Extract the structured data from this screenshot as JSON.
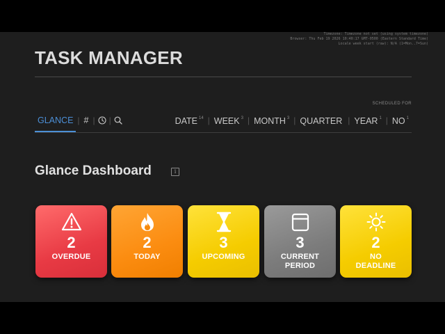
{
  "debug": {
    "lines": [
      "Timezone: Timezone not set (using system timezone)",
      "Browser: Thu Feb 19 2026 10:40:17 GMT-0500 (Eastern Standard Time)",
      "Locale week start (raw): N/A (1=Mon..7=Sun)"
    ]
  },
  "app": {
    "title": "TASK MANAGER"
  },
  "nav": {
    "tabs": [
      {
        "label": "GLANCE",
        "active": true
      },
      {
        "label": "#",
        "active": false
      }
    ],
    "icons": [
      "clock-icon",
      "search-icon"
    ],
    "scheduled_for_label": "SCHEDULED FOR",
    "periods": [
      {
        "label": "DATE",
        "count": "14"
      },
      {
        "label": "WEEK",
        "count": "3"
      },
      {
        "label": "MONTH",
        "count": "3"
      },
      {
        "label": "QUARTER",
        "count": ""
      },
      {
        "label": "YEAR",
        "count": "1"
      },
      {
        "label": "NO",
        "count": "1"
      }
    ]
  },
  "dashboard": {
    "title": "Glance Dashboard",
    "info_icon_glyph": "i",
    "cards": [
      {
        "label": "OVERDUE",
        "count": "2",
        "icon": "warning-icon",
        "color": "#e83a44"
      },
      {
        "label": "TODAY",
        "count": "2",
        "icon": "flame-icon",
        "color": "#fb8c10"
      },
      {
        "label": "UPCOMING",
        "count": "3",
        "icon": "hourglass-icon",
        "color": "#f5cc00"
      },
      {
        "label": "CURRENT PERIOD",
        "label_line1": "CURRENT",
        "label_line2": "PERIOD",
        "count": "3",
        "icon": "calendar-icon",
        "color": "#7c7c7c"
      },
      {
        "label": "NO DEADLINE",
        "label_line1": "NO",
        "label_line2": "DEADLINE",
        "count": "2",
        "icon": "sun-icon",
        "color": "#f5cc00"
      }
    ]
  },
  "colors": {
    "background": "#1e1e1e",
    "accent": "#4c8fd6"
  }
}
